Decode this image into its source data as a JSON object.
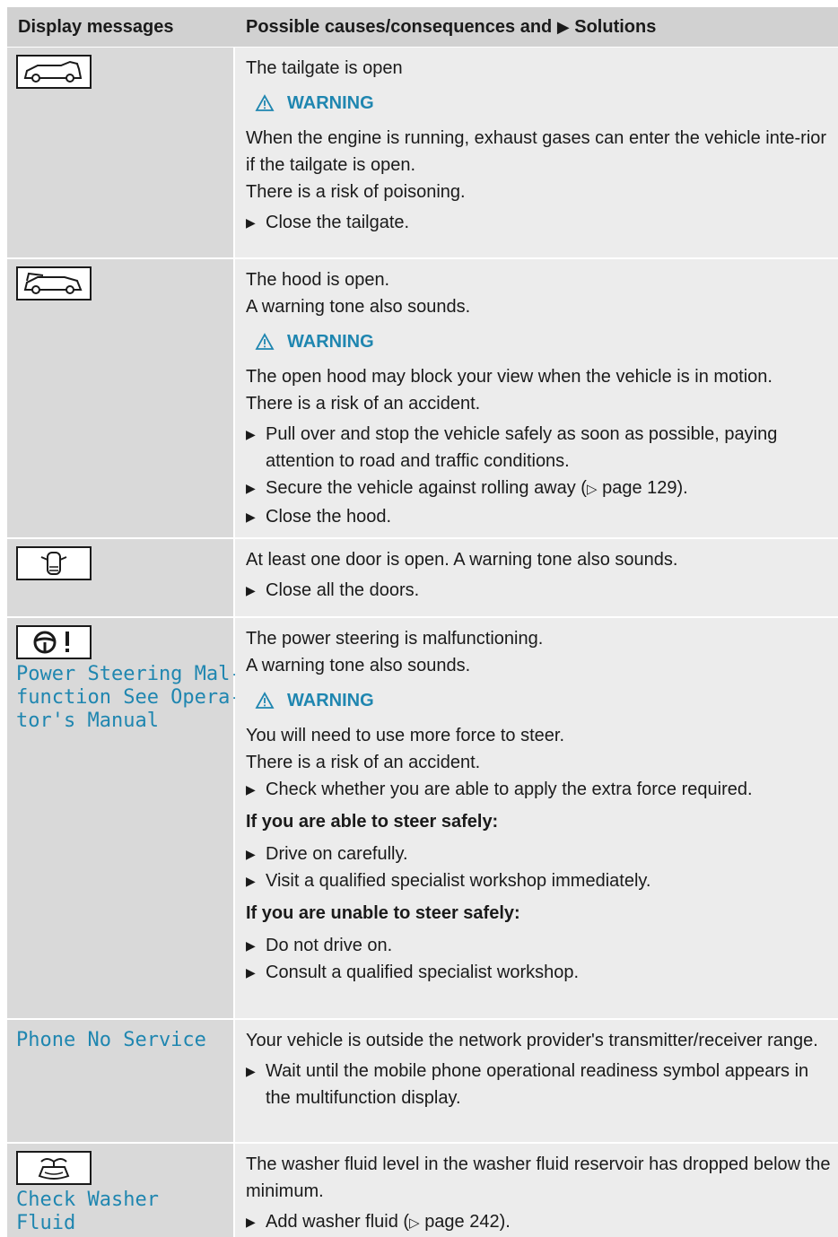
{
  "header": {
    "col1": "Display messages",
    "col2_prefix": "Possible causes/consequences and",
    "col2_suffix": "Solutions"
  },
  "rows": [
    {
      "icon": "tailgate-open-icon",
      "intro1": "The tailgate is open",
      "warning": "WARNING",
      "w1": "When the engine is running, exhaust gases can enter the vehicle inte-rior if the tailgate is open.",
      "w2": "There is a risk of poisoning.",
      "s1": "Close the tailgate."
    },
    {
      "icon": "hood-open-icon",
      "intro1": "The hood is open.",
      "intro2": "A warning tone also sounds.",
      "warning": "WARNING",
      "w1": "The open hood may block your view when the vehicle is in motion.",
      "w2": "There is a risk of an accident.",
      "s1": "Pull over and stop the vehicle safely as soon as possible, paying attention to road and traffic conditions.",
      "s2": "Secure the vehicle against rolling away (",
      "s2_page": "page 129).",
      "s3": "Close the hood."
    },
    {
      "icon": "door-open-icon",
      "intro1": "At least one door is open. A warning tone also sounds.",
      "s1": "Close all the doors."
    },
    {
      "icon": "steering-wheel-warning-icon",
      "display_text": "Power Steering Mal-\nfunction See Opera-\ntor's Manual",
      "intro1": "The power steering is malfunctioning.",
      "intro2": "A warning tone also sounds.",
      "warning": "WARNING",
      "w1": "You will need to use more force to steer.",
      "w2": "There is a risk of an accident.",
      "s1": "Check whether you are able to apply the extra force required.",
      "able_heading": "If you are able to steer safely:",
      "a1": "Drive on carefully.",
      "a2": "Visit a qualified specialist workshop immediately.",
      "unable_heading": "If you are unable to steer safely:",
      "u1": "Do not drive on.",
      "u2": "Consult a qualified specialist workshop."
    },
    {
      "display_text": "Phone No Service",
      "intro1": "Your vehicle is outside the network provider's transmitter/receiver range.",
      "s1": "Wait until the mobile phone operational readiness symbol appears in the multifunction display."
    },
    {
      "icon": "washer-fluid-icon",
      "display_text": "Check Washer Fluid",
      "intro1": "The washer fluid level in the washer fluid reservoir has dropped below the minimum.",
      "s1": "Add washer fluid (",
      "s1_page": "page 242)."
    }
  ],
  "colors": {
    "accent": "#1f86b0",
    "header_bg": "#d1d1d1",
    "left_bg": "#d9d9d9",
    "right_bg": "#ececec"
  }
}
